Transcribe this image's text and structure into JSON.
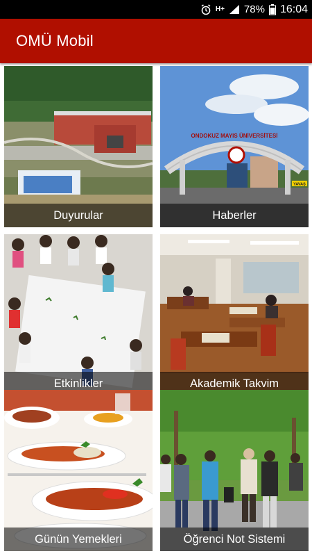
{
  "status_bar": {
    "battery": "78%",
    "time": "16:04",
    "network": "H+",
    "icons": [
      "alarm-icon",
      "signal-icon",
      "battery-icon"
    ]
  },
  "app_bar": {
    "title": "OMÜ Mobil",
    "color": "#b00f00"
  },
  "tiles": [
    {
      "label": "Duyurular",
      "image": "campus-aerial"
    },
    {
      "label": "Haberler",
      "image": "university-gate"
    },
    {
      "label": "Etkinlikler",
      "image": "children-activity"
    },
    {
      "label": "Akademik Takvim",
      "image": "study-hall"
    },
    {
      "label": "Günün Yemekleri",
      "image": "meal-plates"
    },
    {
      "label": "Öğrenci Not Sistemi",
      "image": "students-walking"
    }
  ],
  "gate_sign": {
    "text": "ONDOKUZ MAYIS ÜNİVERSİTESİ",
    "road_sign": "YAVAŞ"
  }
}
